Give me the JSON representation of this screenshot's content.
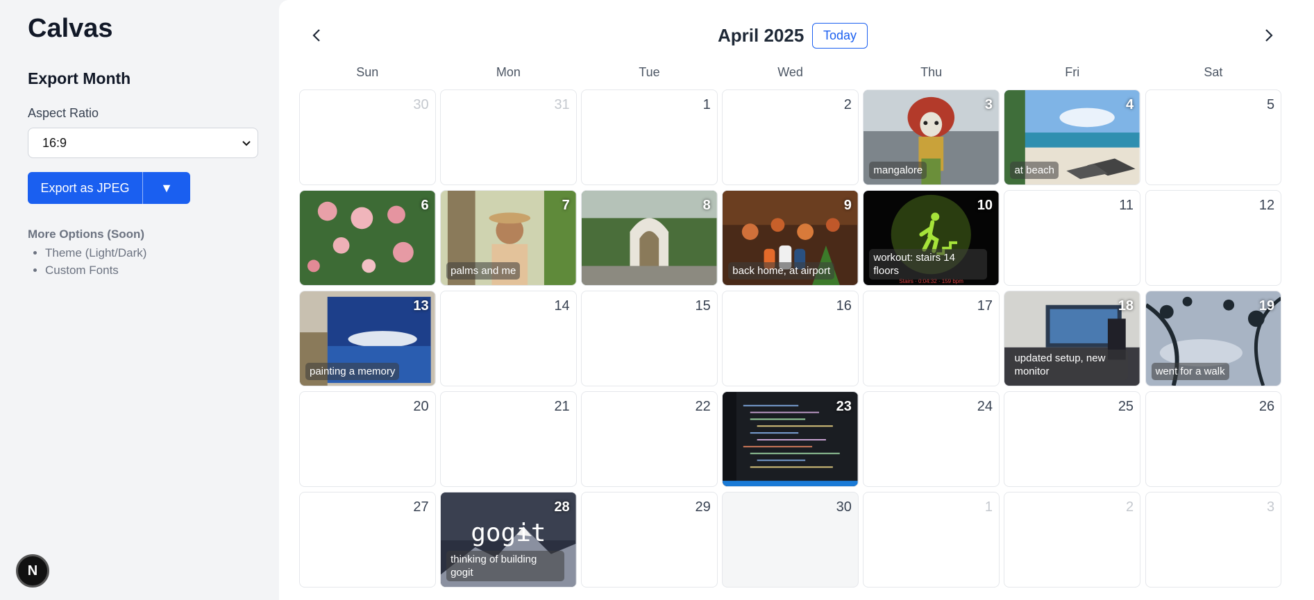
{
  "app": {
    "title": "Calvas"
  },
  "sidebar": {
    "section_title": "Export Month",
    "aspect_label": "Aspect Ratio",
    "aspect_value": "16:9",
    "export_label": "Export as JPEG",
    "dropdown_glyph": "▼",
    "more_title": "More Options (Soon)",
    "more_items": [
      "Theme (Light/Dark)",
      "Custom Fonts"
    ]
  },
  "badge": {
    "letter": "N"
  },
  "calendar": {
    "month_title": "April 2025",
    "today_label": "Today",
    "prev_glyph": "‹",
    "next_glyph": "›",
    "weekdays": [
      "Sun",
      "Mon",
      "Tue",
      "Wed",
      "Thu",
      "Fri",
      "Sat"
    ],
    "weeks": [
      [
        {
          "day": "30",
          "outside": true
        },
        {
          "day": "31",
          "outside": true
        },
        {
          "day": "1"
        },
        {
          "day": "2"
        },
        {
          "day": "3",
          "caption": "mangalore",
          "photo": "statue"
        },
        {
          "day": "4",
          "caption": "at beach",
          "photo": "beach"
        },
        {
          "day": "5"
        }
      ],
      [
        {
          "day": "6",
          "photo": "flowers"
        },
        {
          "day": "7",
          "caption": "palms and me",
          "photo": "palms"
        },
        {
          "day": "8",
          "photo": "garden"
        },
        {
          "day": "9",
          "caption": "back home, at airport",
          "photo": "airport"
        },
        {
          "day": "10",
          "caption": "workout: stairs 14 floors",
          "photo": "workout"
        },
        {
          "day": "11"
        },
        {
          "day": "12"
        }
      ],
      [
        {
          "day": "13",
          "caption": "painting a memory",
          "photo": "painting"
        },
        {
          "day": "14"
        },
        {
          "day": "15"
        },
        {
          "day": "16"
        },
        {
          "day": "17"
        },
        {
          "day": "18",
          "caption": "updated setup, new monitor",
          "photo": "setup"
        },
        {
          "day": "19",
          "caption": "went for a walk",
          "photo": "walk"
        }
      ],
      [
        {
          "day": "20"
        },
        {
          "day": "21"
        },
        {
          "day": "22"
        },
        {
          "day": "23",
          "photo": "code"
        },
        {
          "day": "24"
        },
        {
          "day": "25"
        },
        {
          "day": "26"
        }
      ],
      [
        {
          "day": "27"
        },
        {
          "day": "28",
          "caption": "thinking of building gogit",
          "photo": "gogit"
        },
        {
          "day": "29"
        },
        {
          "day": "30",
          "muted": true
        },
        {
          "day": "1",
          "outside": true
        },
        {
          "day": "2",
          "outside": true
        },
        {
          "day": "3",
          "outside": true
        }
      ]
    ],
    "gogit_text": "gogit",
    "workout_stats": "Stairs · 0:04:32 · 159 bpm"
  }
}
